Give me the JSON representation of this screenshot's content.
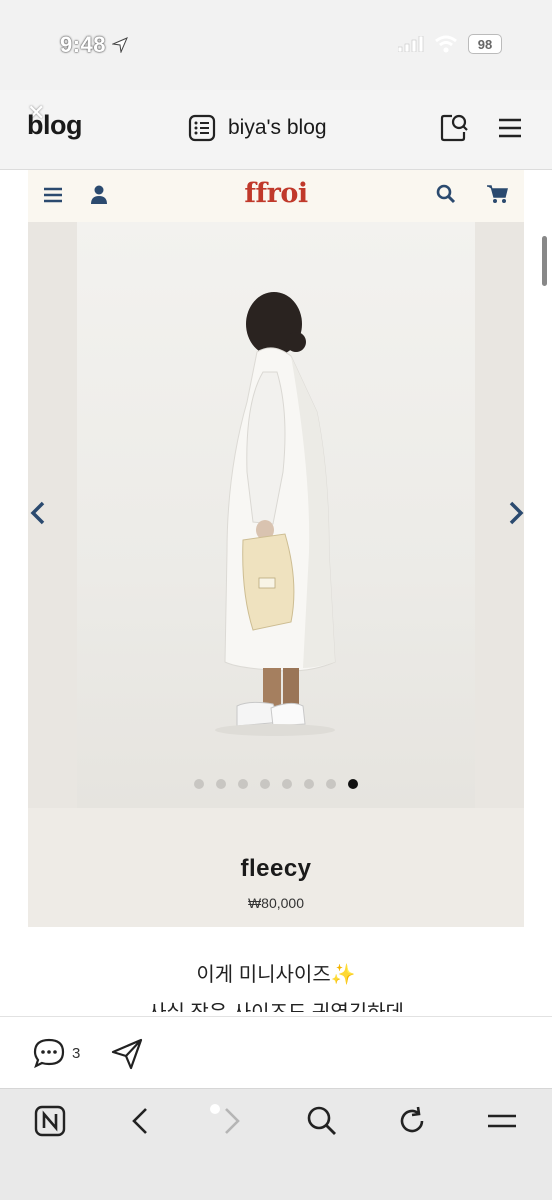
{
  "status_bar": {
    "time": "9:48",
    "battery": "98"
  },
  "blog_header": {
    "logo": "blog",
    "title": "biya's blog"
  },
  "shop": {
    "brand": "ffroi",
    "product_name": "fleecy",
    "product_price": "₩80,000",
    "carousel": {
      "total": 8,
      "active_index": 8
    }
  },
  "post": {
    "line1": "이게 미니사이즈✨",
    "line2": "사실 작은 사이즈도 귀엽긴하데"
  },
  "actions": {
    "comment_count": "3"
  },
  "colors": {
    "brand_red": "#c0392b",
    "nav_icon_blue": "#2b4a6f"
  },
  "icons": {
    "header": [
      "list-icon",
      "search-doc-icon",
      "hamburger-menu-icon"
    ],
    "shop_nav": [
      "hamburger-icon",
      "user-icon",
      "search-icon",
      "cart-icon"
    ],
    "browser": [
      "naver-home-icon",
      "back-icon",
      "forward-icon",
      "search-icon",
      "refresh-icon",
      "menu-icon"
    ]
  }
}
